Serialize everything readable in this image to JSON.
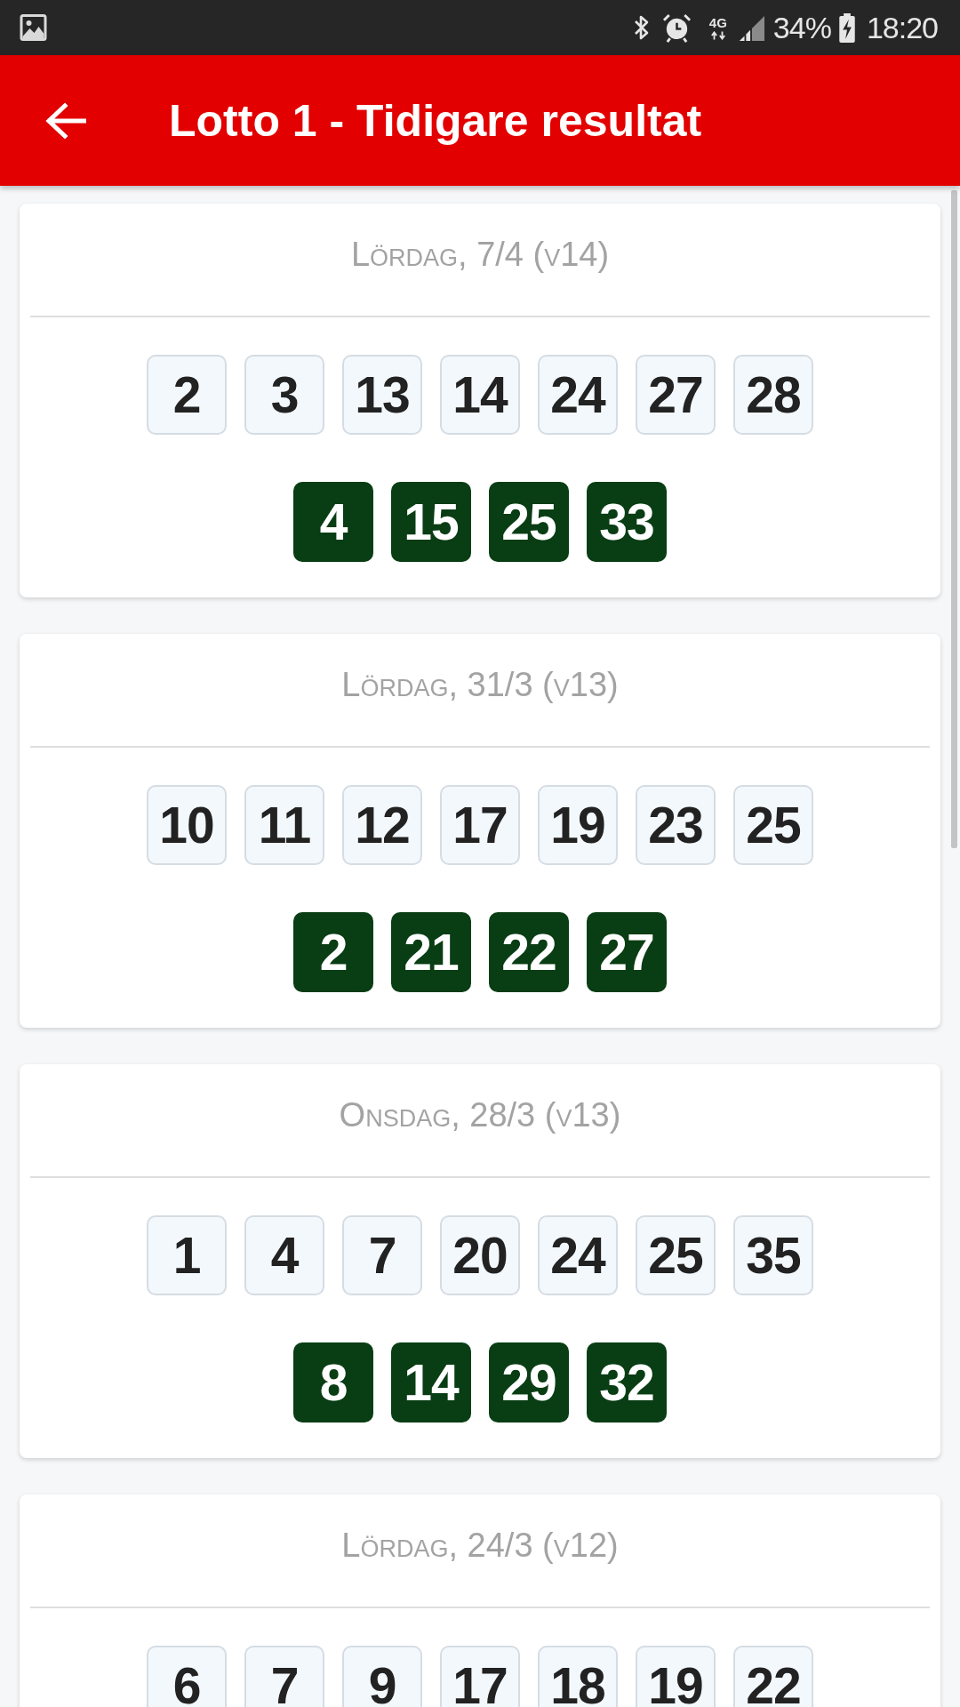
{
  "status_bar": {
    "network": "4G",
    "battery": "34%",
    "time": "18:20"
  },
  "app_bar": {
    "title": "Lotto 1 - Tidigare resultat"
  },
  "draws": [
    {
      "date": "Lördag, 7/4 (v14)",
      "numbers": [
        "2",
        "3",
        "13",
        "14",
        "24",
        "27",
        "28"
      ],
      "extra_numbers": [
        "4",
        "15",
        "25",
        "33"
      ]
    },
    {
      "date": "Lördag, 31/3 (v13)",
      "numbers": [
        "10",
        "11",
        "12",
        "17",
        "19",
        "23",
        "25"
      ],
      "extra_numbers": [
        "2",
        "21",
        "22",
        "27"
      ]
    },
    {
      "date": "Onsdag, 28/3 (v13)",
      "numbers": [
        "1",
        "4",
        "7",
        "20",
        "24",
        "25",
        "35"
      ],
      "extra_numbers": [
        "8",
        "14",
        "29",
        "32"
      ]
    },
    {
      "date": "Lördag, 24/3 (v12)",
      "numbers": [
        "6",
        "7",
        "9",
        "17",
        "18",
        "19",
        "22"
      ]
    }
  ]
}
